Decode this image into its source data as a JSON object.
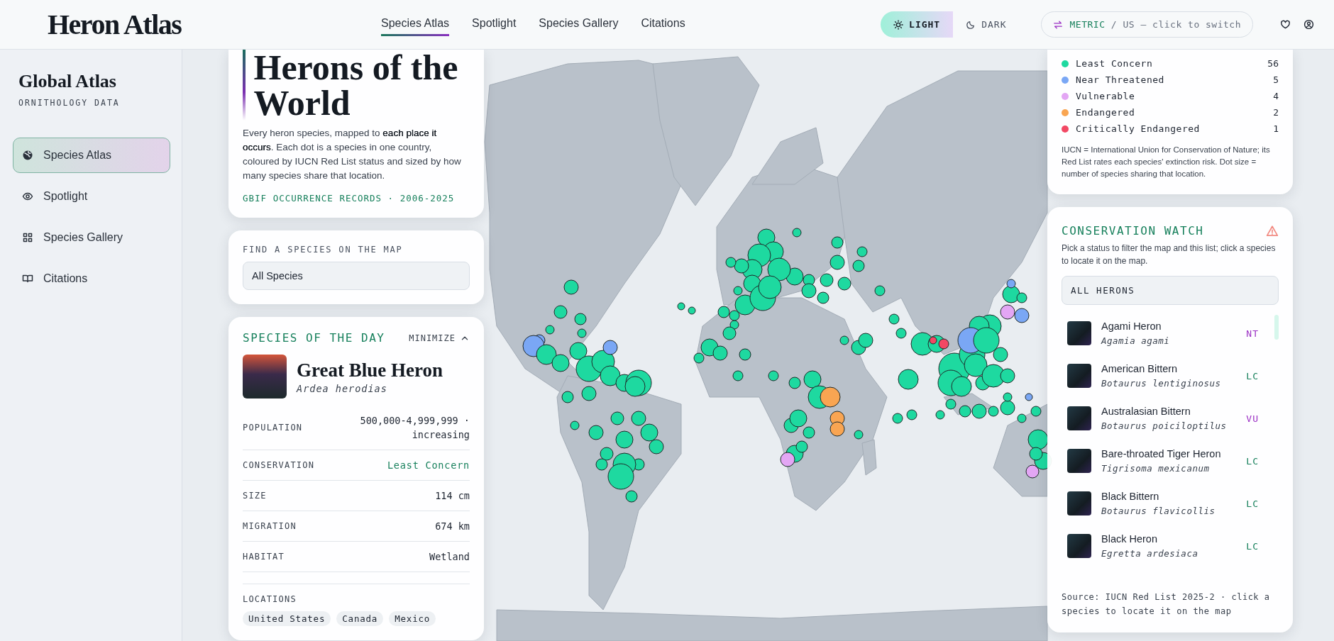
{
  "header": {
    "logo": "Heron Atlas",
    "nav": [
      {
        "label": "Species Atlas",
        "selected": true
      },
      {
        "label": "Spotlight",
        "selected": false
      },
      {
        "label": "Species Gallery",
        "selected": false
      },
      {
        "label": "Citations",
        "selected": false
      }
    ],
    "theme": [
      {
        "label": "LIGHT",
        "kind": "sun",
        "selected": true
      },
      {
        "label": "DARK",
        "kind": "moon",
        "selected": false
      }
    ],
    "units": {
      "active": "METRIC",
      "rest": "/ US — click to switch"
    }
  },
  "sidebar": {
    "title": "Global Atlas",
    "subtitle": "ORNITHOLOGY DATA",
    "items": [
      {
        "label": "Species Atlas",
        "kind": "globe",
        "selected": true
      },
      {
        "label": "Spotlight",
        "kind": "eye",
        "selected": false
      },
      {
        "label": "Species Gallery",
        "kind": "grid",
        "selected": false
      },
      {
        "label": "Citations",
        "kind": "book",
        "selected": false
      }
    ]
  },
  "intro": {
    "title": "Herons of the World",
    "description": "Every heron species, mapped to **each place it occurs**. Each dot is a species in one country, coloured by IUCN Red List status and sized by how many species share that location.",
    "source": "GBIF OCCURRENCE RECORDS · 2006-2025"
  },
  "finder": {
    "label": "FIND A SPECIES ON THE MAP",
    "value": "All Species"
  },
  "species_of_day": {
    "title": "SPECIES OF THE DAY",
    "toggle": "MINIMIZE",
    "name": "Great Blue Heron",
    "scientific": "Ardea herodias",
    "stats": [
      {
        "label": "POPULATION",
        "value": "500,000-4,999,999 · increasing",
        "kind": "text"
      },
      {
        "label": "CONSERVATION",
        "value": "Least Concern",
        "kind": "status"
      },
      {
        "label": "SIZE",
        "value": "114 cm",
        "kind": "text"
      },
      {
        "label": "MIGRATION",
        "value": "674 km",
        "kind": "text"
      },
      {
        "label": "HABITAT",
        "value": "Wetland",
        "kind": "text"
      }
    ],
    "locations_label": "LOCATIONS",
    "locations": [
      "United States",
      "Canada",
      "Mexico"
    ]
  },
  "legend": {
    "items": [
      {
        "label": "Least Concern",
        "count": "56",
        "color": "#1ed9a0"
      },
      {
        "label": "Near Threatened",
        "count": "5",
        "color": "#7aa7f5"
      },
      {
        "label": "Vulnerable",
        "count": "4",
        "color": "#e3a6f4"
      },
      {
        "label": "Endangered",
        "count": "2",
        "color": "#f9a552"
      },
      {
        "label": "Critically Endangered",
        "count": "1",
        "color": "#f24864"
      }
    ],
    "note": "IUCN = International Union for Conservation of Nature; its Red List rates each species' extinction risk. Dot size = number of species sharing that location."
  },
  "watch": {
    "title": "CONSERVATION WATCH",
    "description": "Pick a status to filter the map and this list; click a species to locate it on the map.",
    "filter": "ALL HERONS",
    "species": [
      {
        "name": "Agami Heron",
        "scientific": "Agamia agami",
        "code": "NT",
        "color": "#9b2fc4"
      },
      {
        "name": "American Bittern",
        "scientific": "Botaurus lentiginosus",
        "code": "LC",
        "color": "#17805c"
      },
      {
        "name": "Australasian Bittern",
        "scientific": "Botaurus poiciloptilus",
        "code": "VU",
        "color": "#9b2fc4"
      },
      {
        "name": "Bare-throated Tiger Heron",
        "scientific": "Tigrisoma mexicanum",
        "code": "LC",
        "color": "#17805c"
      },
      {
        "name": "Black Bittern",
        "scientific": "Botaurus flavicollis",
        "code": "LC",
        "color": "#17805c"
      },
      {
        "name": "Black Heron",
        "scientific": "Egretta ardesiaca",
        "code": "LC",
        "color": "#17805c"
      }
    ],
    "source": "Source: IUCN Red List 2025-2 · click a species to locate it on the map"
  }
}
